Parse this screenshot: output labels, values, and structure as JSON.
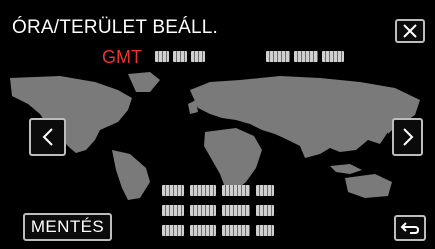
{
  "header": {
    "title": "ÓRA/TERÜLET BEÁLL."
  },
  "timezone": {
    "gmt_label": "GMT"
  },
  "footer": {
    "save_label": "MENTÉS"
  },
  "icons": {
    "close": "close-icon",
    "prev": "chevron-left-icon",
    "next": "chevron-right-icon",
    "back": "return-icon"
  },
  "colors": {
    "gmt_label": "#e8332e",
    "map_land": "#7a7a7a",
    "background": "#000000"
  }
}
